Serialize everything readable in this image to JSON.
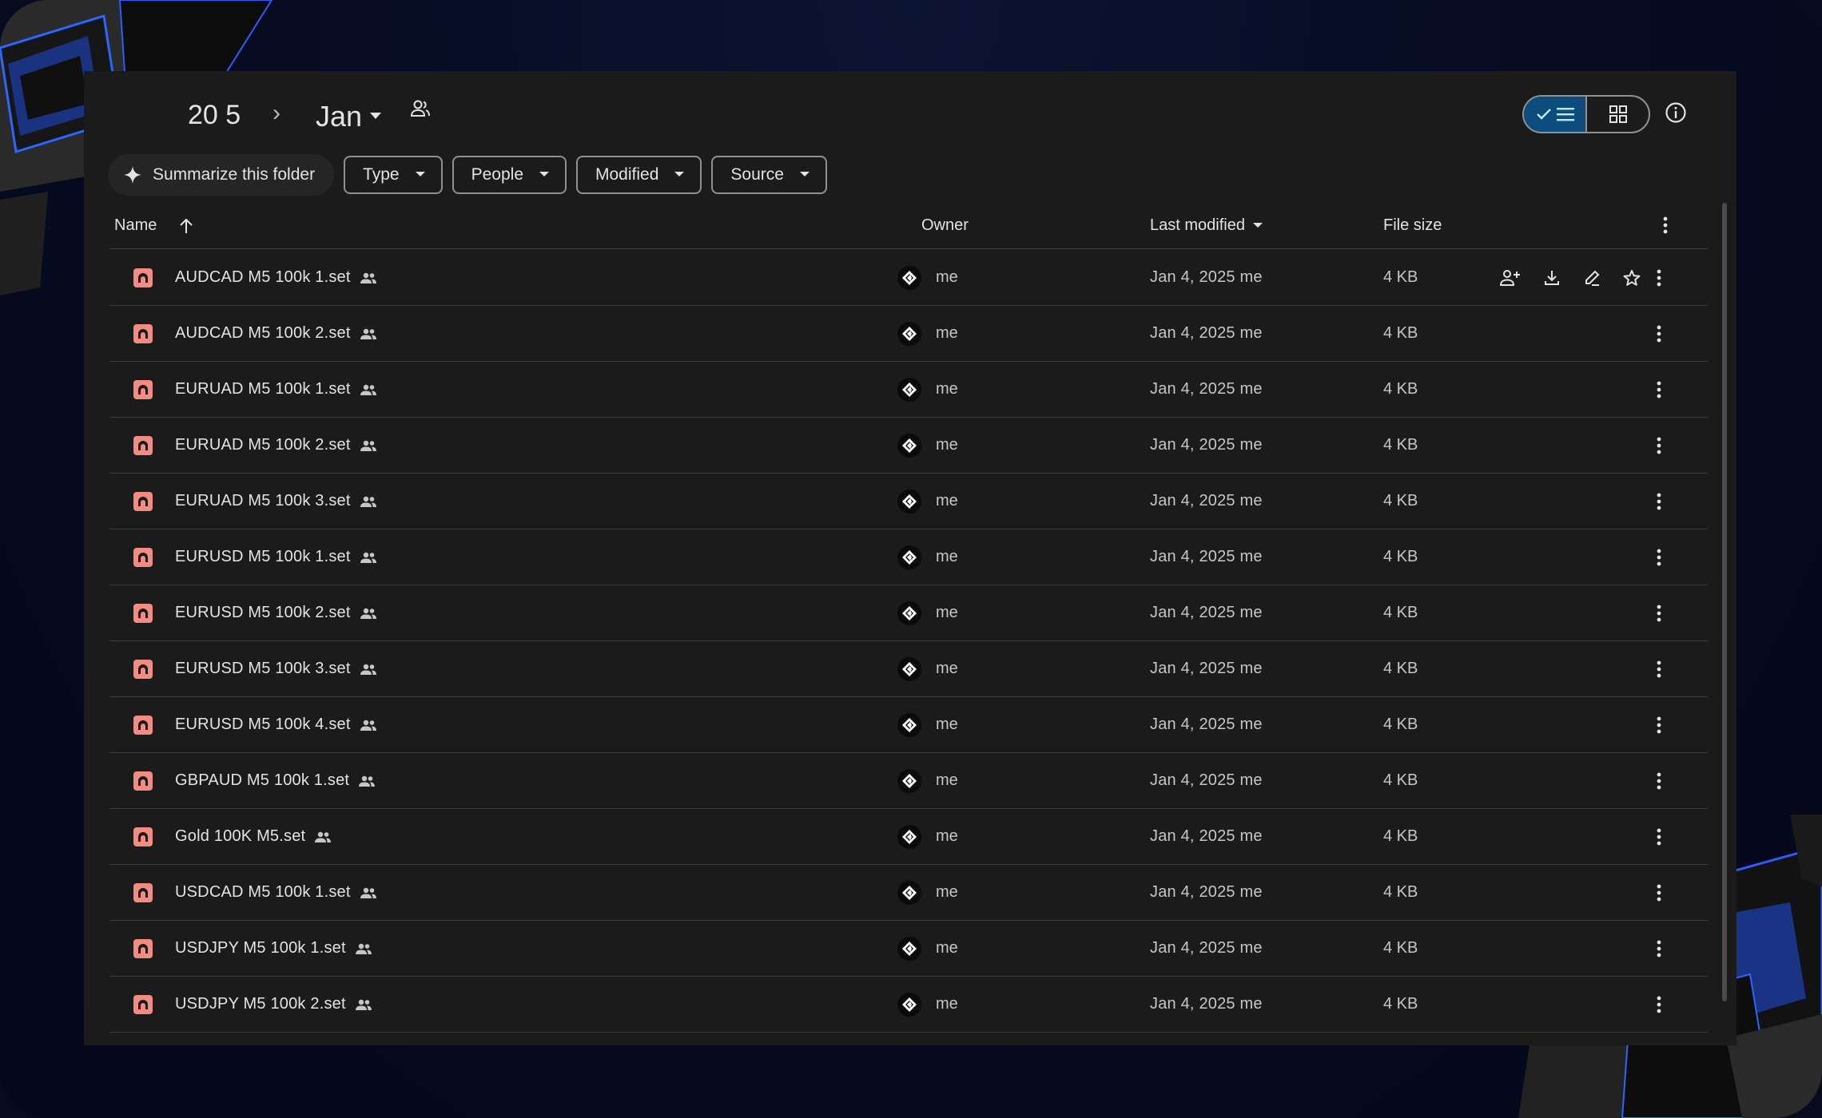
{
  "breadcrumb": {
    "parent": "20 5",
    "separator": "›",
    "current": "Jan"
  },
  "toolbar": {
    "summarize_label": "Summarize this folder",
    "filters": [
      "Type",
      "People",
      "Modified",
      "Source"
    ]
  },
  "table": {
    "columns": {
      "name": "Name",
      "owner": "Owner",
      "last_modified": "Last modified",
      "file_size": "File size"
    },
    "rows": [
      {
        "name": "AUDCAD M5 100k 1.set",
        "owner": "me",
        "modified": "Jan 4, 2025 me",
        "size": "4 KB"
      },
      {
        "name": "AUDCAD M5 100k 2.set",
        "owner": "me",
        "modified": "Jan 4, 2025 me",
        "size": "4 KB"
      },
      {
        "name": "EURUAD M5 100k 1.set",
        "owner": "me",
        "modified": "Jan 4, 2025 me",
        "size": "4 KB"
      },
      {
        "name": "EURUAD M5 100k 2.set",
        "owner": "me",
        "modified": "Jan 4, 2025 me",
        "size": "4 KB"
      },
      {
        "name": "EURUAD M5 100k 3.set",
        "owner": "me",
        "modified": "Jan 4, 2025 me",
        "size": "4 KB"
      },
      {
        "name": "EURUSD M5 100k 1.set",
        "owner": "me",
        "modified": "Jan 4, 2025 me",
        "size": "4 KB"
      },
      {
        "name": "EURUSD M5 100k 2.set",
        "owner": "me",
        "modified": "Jan 4, 2025 me",
        "size": "4 KB"
      },
      {
        "name": "EURUSD M5 100k 3.set",
        "owner": "me",
        "modified": "Jan 4, 2025 me",
        "size": "4 KB"
      },
      {
        "name": "EURUSD M5 100k 4.set",
        "owner": "me",
        "modified": "Jan 4, 2025 me",
        "size": "4 KB"
      },
      {
        "name": "GBPAUD M5 100k 1.set",
        "owner": "me",
        "modified": "Jan 4, 2025 me",
        "size": "4 KB"
      },
      {
        "name": "Gold 100K M5.set",
        "owner": "me",
        "modified": "Jan 4, 2025 me",
        "size": "4 KB"
      },
      {
        "name": "USDCAD M5 100k 1.set",
        "owner": "me",
        "modified": "Jan 4, 2025 me",
        "size": "4 KB"
      },
      {
        "name": "USDJPY M5 100k 1.set",
        "owner": "me",
        "modified": "Jan 4, 2025 me",
        "size": "4 KB"
      },
      {
        "name": "USDJPY M5 100k 2.set",
        "owner": "me",
        "modified": "Jan 4, 2025 me",
        "size": "4 KB"
      }
    ],
    "hovered_row_actions": [
      "share-icon",
      "download-icon",
      "rename-icon",
      "star-icon"
    ]
  },
  "icons": {
    "file": "file-icon",
    "shared": "shared-people-icon",
    "more": "more-vert-icon",
    "list_view": "list-view-icon",
    "grid_view": "grid-view-icon",
    "info": "info-icon"
  },
  "colors": {
    "file_icon": "#f28b82",
    "toggle_active": "#0c4d7e",
    "surface": "#1b1b1b"
  }
}
